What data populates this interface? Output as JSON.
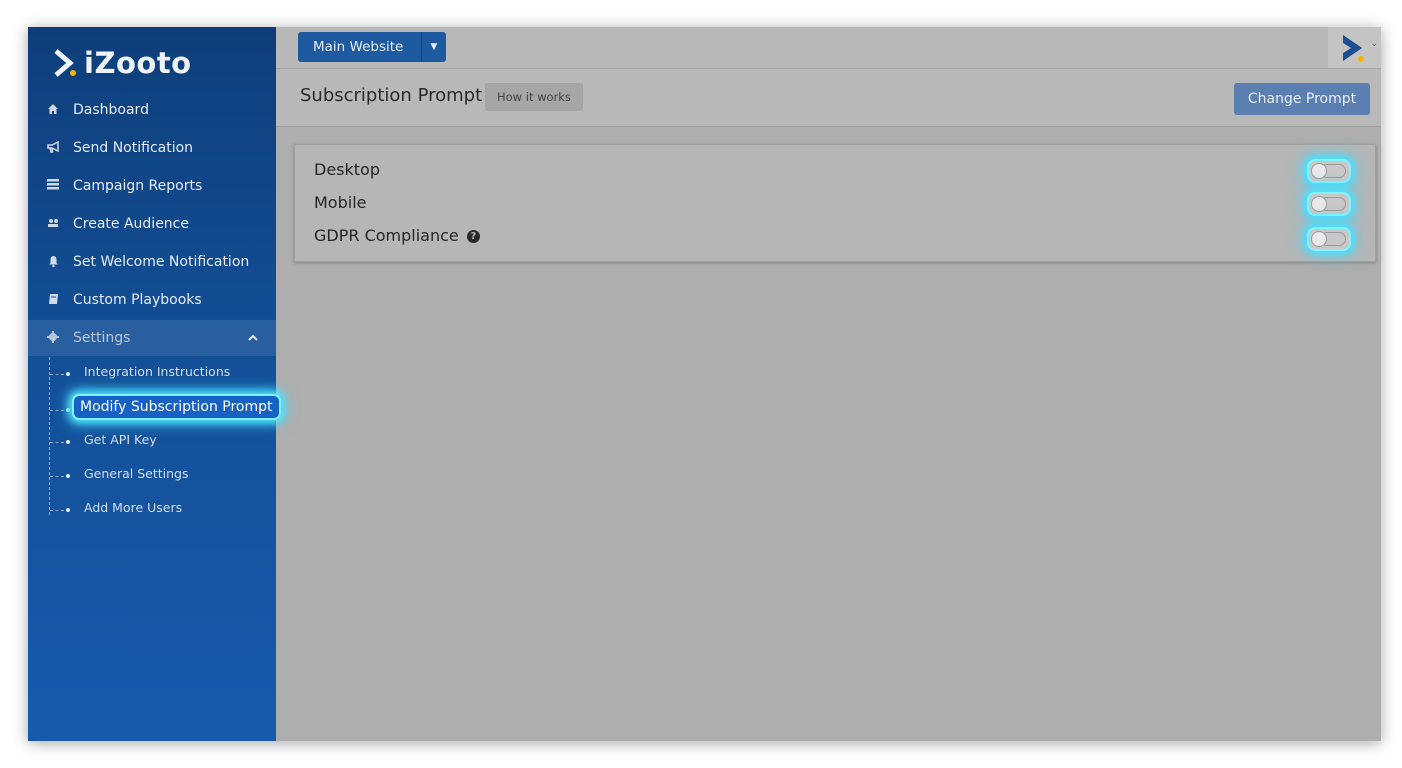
{
  "brand": {
    "name": "iZooto",
    "accent": "#f5b400",
    "primary": "#1e5aa0"
  },
  "sidebar": {
    "items": [
      {
        "icon": "home-icon",
        "label": "Dashboard"
      },
      {
        "icon": "megaphone-icon",
        "label": "Send Notification"
      },
      {
        "icon": "reports-icon",
        "label": "Campaign Reports"
      },
      {
        "icon": "audience-icon",
        "label": "Create Audience"
      },
      {
        "icon": "bell-icon",
        "label": "Set Welcome Notification"
      },
      {
        "icon": "book-icon",
        "label": "Custom Playbooks"
      },
      {
        "icon": "gear-icon",
        "label": "Settings",
        "expanded": true
      }
    ],
    "settings_sub": [
      {
        "label": "Integration Instructions"
      },
      {
        "label": "Modify Subscription Prompt",
        "active": true
      },
      {
        "label": "Get API Key"
      },
      {
        "label": "General Settings"
      },
      {
        "label": "Add More Users"
      }
    ]
  },
  "topbar": {
    "site_selector": "Main Website"
  },
  "header": {
    "title": "Subscription Prompt",
    "how_it_works": "How it works",
    "change_prompt": "Change Prompt"
  },
  "settings": {
    "rows": [
      {
        "label": "Desktop",
        "enabled": false
      },
      {
        "label": "Mobile",
        "enabled": false
      },
      {
        "label": "GDPR Compliance",
        "enabled": false,
        "help_icon": "question-circle-icon"
      }
    ]
  }
}
